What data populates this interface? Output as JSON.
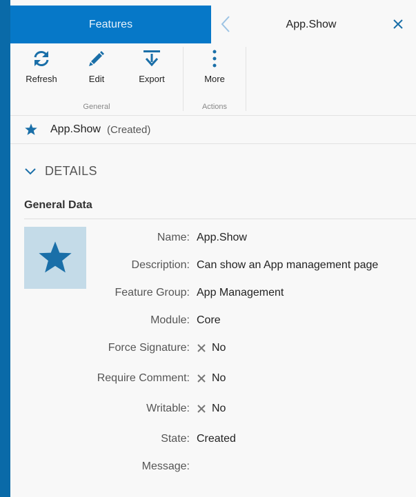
{
  "tabs": {
    "features_label": "Features",
    "active_title": "App.Show"
  },
  "ribbon": {
    "refresh_label": "Refresh",
    "edit_label": "Edit",
    "export_label": "Export",
    "more_label": "More",
    "group_general": "General",
    "group_actions": "Actions"
  },
  "record": {
    "name": "App.Show",
    "status": "(Created)"
  },
  "details": {
    "section_title": "DETAILS",
    "group_title": "General Data",
    "fields": [
      {
        "label": "Name:",
        "value": "App.Show"
      },
      {
        "label": "Description:",
        "value": "Can show an App management page"
      },
      {
        "label": "Feature Group:",
        "value": "App Management"
      },
      {
        "label": "Module:",
        "value": "Core"
      },
      {
        "label": "Force Signature:",
        "value": "No"
      },
      {
        "label": "Require Comment:",
        "value": "No"
      },
      {
        "label": "Writable:",
        "value": "No"
      },
      {
        "label": "State:",
        "value": "Created"
      },
      {
        "label": "Message:",
        "value": ""
      }
    ]
  },
  "colors": {
    "accent": "#0678c8",
    "icon_blue": "#1a6fa8",
    "image_bg": "#c4dbe8"
  },
  "icons": [
    "refresh-icon",
    "pencil-icon",
    "download-icon",
    "more-vertical-icon",
    "star-icon",
    "chevron-left-icon",
    "close-icon",
    "chevron-down-icon",
    "x-icon"
  ]
}
